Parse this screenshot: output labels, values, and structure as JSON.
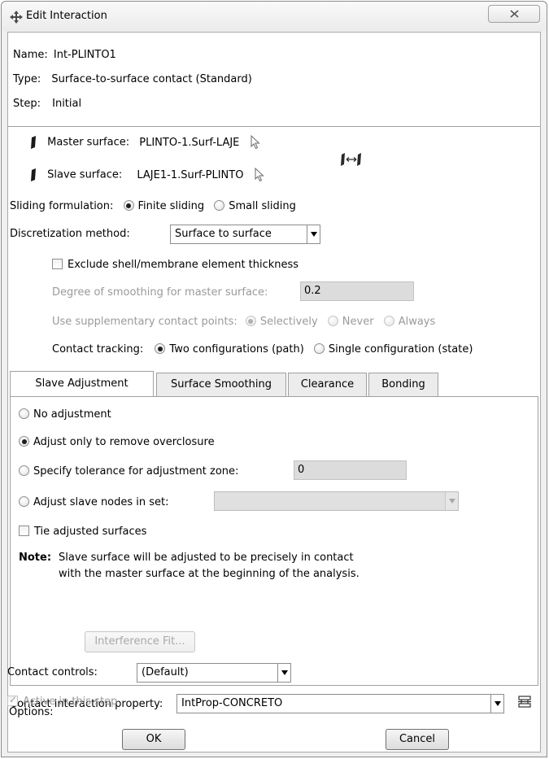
{
  "window": {
    "title": "Edit Interaction"
  },
  "info": {
    "name_label": "Name:",
    "name_value": "Int-PLINTO1",
    "type_label": "Type:",
    "type_value": "Surface-to-surface contact (Standard)",
    "step_label": "Step:",
    "step_value": "Initial"
  },
  "surfaces": {
    "master_label": "Master surface:",
    "master_value": "PLINTO-1.Surf-LAJE",
    "slave_label": "Slave surface:",
    "slave_value": "LAJE1-1.Surf-PLINTO"
  },
  "sliding": {
    "label": "Sliding formulation:",
    "options": [
      "Finite sliding",
      "Small sliding"
    ],
    "selected": "Finite sliding"
  },
  "discretization": {
    "label": "Discretization method:",
    "value": "Surface to surface"
  },
  "exclude_shell": {
    "label": "Exclude shell/membrane element thickness",
    "checked": false
  },
  "smoothing": {
    "label": "Degree of smoothing for master surface:",
    "value": "0.2"
  },
  "supplementary": {
    "label": "Use supplementary contact points:",
    "options": [
      "Selectively",
      "Never",
      "Always"
    ],
    "selected": "Selectively"
  },
  "tracking": {
    "label": "Contact tracking:",
    "options": [
      "Two configurations (path)",
      "Single configuration (state)"
    ],
    "selected": "Two configurations (path)"
  },
  "tabs": [
    "Slave Adjustment",
    "Surface Smoothing",
    "Clearance",
    "Bonding"
  ],
  "active_tab": "Slave Adjustment",
  "slave_adjustment": {
    "options": [
      "No adjustment",
      "Adjust only to remove overclosure",
      "Specify tolerance for adjustment zone:",
      "Adjust slave nodes in set:"
    ],
    "selected": "Adjust only to remove overclosure",
    "tolerance_value": "0",
    "node_set_value": "",
    "tie_label": "Tie adjusted surfaces",
    "tie_checked": false,
    "note_label": "Note:",
    "note_line1": "Slave surface will be adjusted to be precisely in contact",
    "note_line2": "with the master surface at the beginning of the analysis."
  },
  "property": {
    "label": "Contact interaction property:",
    "value": "IntProp-CONCRETO"
  },
  "options": {
    "label": "Options:",
    "button": "Interference Fit..."
  },
  "controls": {
    "label": "Contact controls:",
    "value": "(Default)"
  },
  "active": {
    "label": "Active in this step",
    "checked": true
  },
  "buttons": {
    "ok": "OK",
    "cancel": "Cancel"
  },
  "icons": {
    "title": "move-arrows-icon",
    "close": "close-icon",
    "surface": "surface-icon",
    "select": "cursor-icon",
    "swap": "swap-surfaces-icon",
    "property_manager": "property-manager-icon"
  }
}
